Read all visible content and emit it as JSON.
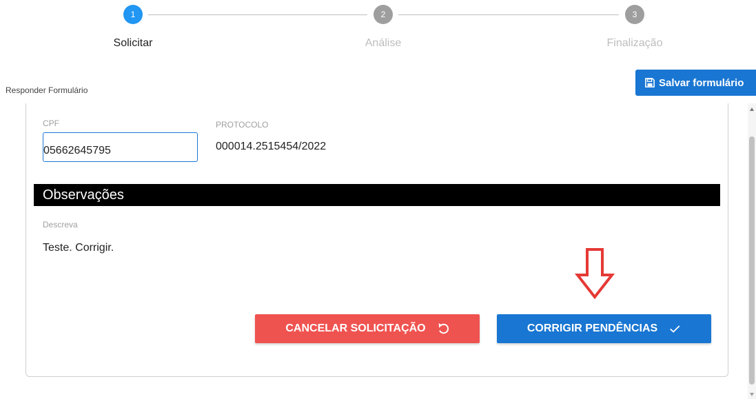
{
  "stepper": {
    "steps": [
      {
        "number": "1",
        "label": "Solicitar",
        "state": "active"
      },
      {
        "number": "2",
        "label": "Análise",
        "state": "inactive"
      },
      {
        "number": "3",
        "label": "Finalização",
        "state": "inactive"
      }
    ]
  },
  "form": {
    "title": "Responder Formulário",
    "save_label": "Salvar formulário",
    "cpf_label": "CPF",
    "cpf_value": "05662645795",
    "protocol_label": "PROTOCOLO",
    "protocol_value": "000014.2515454/2022",
    "observations_title": "Observações",
    "describe_label": "Descreva",
    "describe_value": "Teste. Corrigir."
  },
  "actions": {
    "cancel_label": "CANCELAR SOLICITAÇÃO",
    "fix_label": "CORRIGIR PENDÊNCIAS"
  },
  "icons": {
    "save": "save-icon",
    "undo": "undo-icon",
    "check": "check-icon",
    "annotation": "red-down-arrow-icon"
  },
  "colors": {
    "primary": "#1976d2",
    "step_active": "#2196f3",
    "danger": "#ef5350",
    "annotation": "#e53935"
  }
}
